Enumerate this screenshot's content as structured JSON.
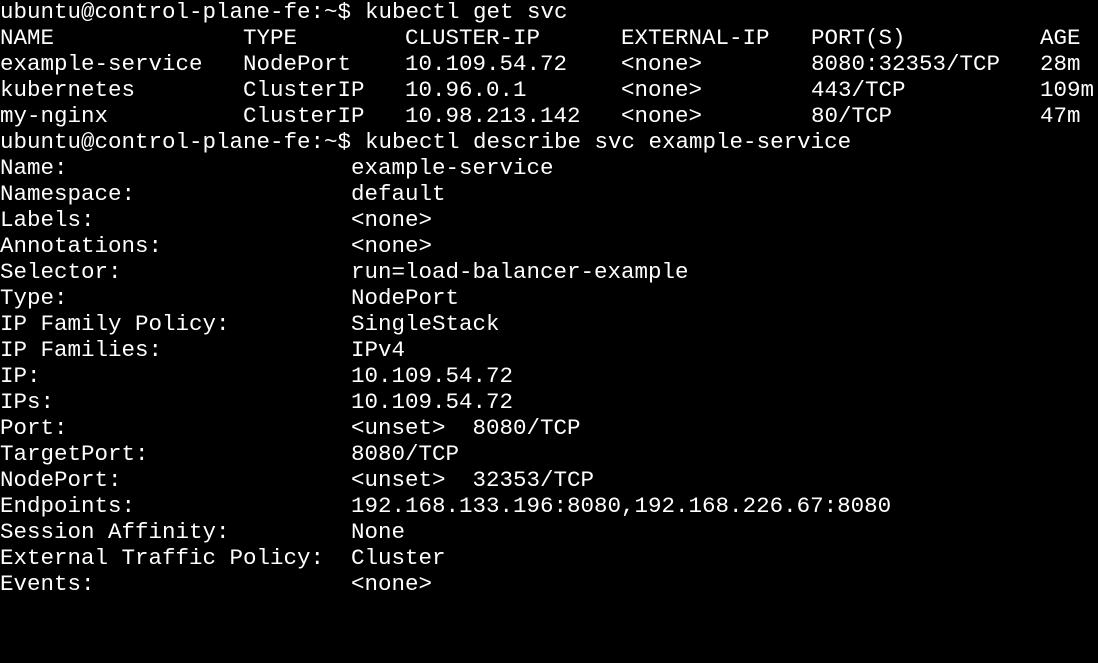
{
  "prompt": "ubuntu@control-plane-fe:~$",
  "commands": {
    "get_svc": "kubectl get svc",
    "describe_svc": "kubectl describe svc example-service"
  },
  "svc_table": {
    "headers": [
      "NAME",
      "TYPE",
      "CLUSTER-IP",
      "EXTERNAL-IP",
      "PORT(S)",
      "AGE"
    ],
    "rows": [
      [
        "example-service",
        "NodePort",
        "10.109.54.72",
        "<none>",
        "8080:32353/TCP",
        "28m"
      ],
      [
        "kubernetes",
        "ClusterIP",
        "10.96.0.1",
        "<none>",
        "443/TCP",
        "109m"
      ],
      [
        "my-nginx",
        "ClusterIP",
        "10.98.213.142",
        "<none>",
        "80/TCP",
        "47m"
      ]
    ]
  },
  "describe": [
    {
      "key": "Name:",
      "value": "example-service"
    },
    {
      "key": "Namespace:",
      "value": "default"
    },
    {
      "key": "Labels:",
      "value": "<none>"
    },
    {
      "key": "Annotations:",
      "value": "<none>"
    },
    {
      "key": "Selector:",
      "value": "run=load-balancer-example"
    },
    {
      "key": "Type:",
      "value": "NodePort"
    },
    {
      "key": "IP Family Policy:",
      "value": "SingleStack"
    },
    {
      "key": "IP Families:",
      "value": "IPv4"
    },
    {
      "key": "IP:",
      "value": "10.109.54.72"
    },
    {
      "key": "IPs:",
      "value": "10.109.54.72"
    },
    {
      "key": "Port:",
      "value": "<unset>  8080/TCP"
    },
    {
      "key": "TargetPort:",
      "value": "8080/TCP"
    },
    {
      "key": "NodePort:",
      "value": "<unset>  32353/TCP"
    },
    {
      "key": "Endpoints:",
      "value": "192.168.133.196:8080,192.168.226.67:8080"
    },
    {
      "key": "Session Affinity:",
      "value": "None"
    },
    {
      "key": "External Traffic Policy:",
      "value": "Cluster"
    },
    {
      "key": "Events:",
      "value": "<none>"
    }
  ],
  "colors": {
    "background": "#000000",
    "foreground": "#ffffff"
  }
}
